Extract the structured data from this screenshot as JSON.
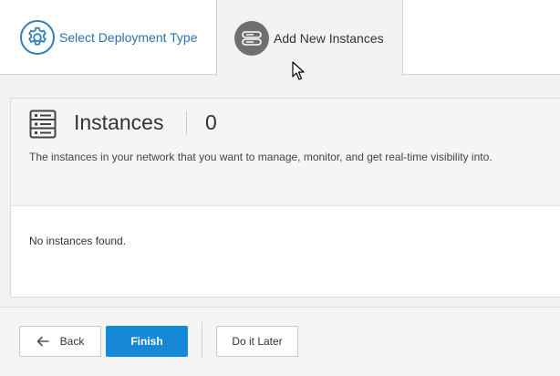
{
  "wizard": {
    "steps": [
      {
        "label": "Select Deployment Type",
        "icon": "gear-icon",
        "state": "completed"
      },
      {
        "label": "Add New Instances",
        "icon": "instance-icon",
        "state": "active"
      }
    ]
  },
  "panel": {
    "title": "Instances",
    "count": "0",
    "description": "The instances in your network that you want to manage, monitor, and get real-time visibility into.",
    "empty_message": "No instances found.",
    "icon": "server-rack-icon"
  },
  "footer": {
    "back_label": "Back",
    "finish_label": "Finish",
    "later_label": "Do it Later"
  },
  "colors": {
    "accent": "#1589d8",
    "link": "#2a73b0",
    "active_step_circle": "#6f6f6f"
  }
}
